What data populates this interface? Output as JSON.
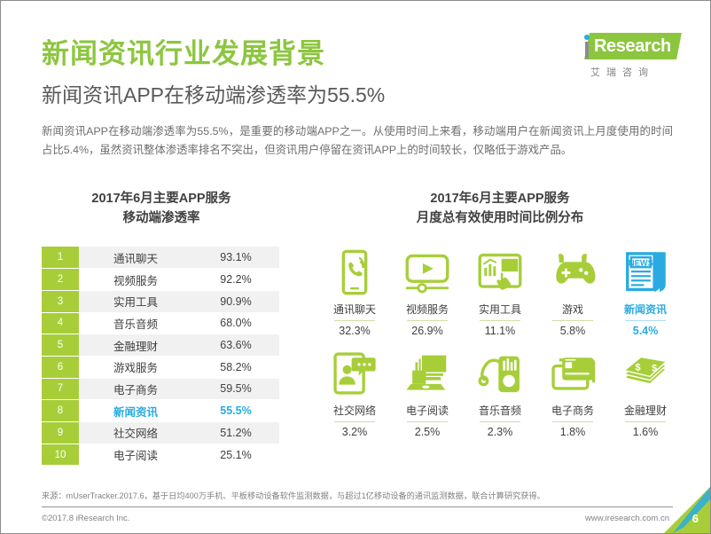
{
  "header": {
    "title": "新闻资讯行业发展背景",
    "subtitle": "新闻资讯APP在移动端渗透率为55.5%",
    "title_color": "#8cc63f",
    "subtitle_color": "#58595b"
  },
  "logo": {
    "word": "Research",
    "cn": "艾瑞咨询",
    "green": "#8cc63f",
    "blue": "#29abe2"
  },
  "intro": {
    "paragraph": "新闻资讯APP在移动端渗透率为55.5%，是重要的移动端APP之一。从使用时间上来看，移动端用户在新闻资讯上月度使用的时间占比5.4%，虽然资讯整体渗透率排名不突出，但资讯用户停留在资讯APP上的时间较长，仅略低于游戏产品。"
  },
  "left_panel": {
    "title_line1": "2017年6月主要APP服务",
    "title_line2": "移动端渗透率",
    "rows": [
      {
        "rank": "1",
        "name": "通讯聊天",
        "value": "93.1%",
        "highlight": false
      },
      {
        "rank": "2",
        "name": "视频服务",
        "value": "92.2%",
        "highlight": false
      },
      {
        "rank": "3",
        "name": "实用工具",
        "value": "90.9%",
        "highlight": false
      },
      {
        "rank": "4",
        "name": "音乐音频",
        "value": "68.0%",
        "highlight": false
      },
      {
        "rank": "5",
        "name": "金融理财",
        "value": "63.6%",
        "highlight": false
      },
      {
        "rank": "6",
        "name": "游戏服务",
        "value": "58.2%",
        "highlight": false
      },
      {
        "rank": "7",
        "name": "电子商务",
        "value": "59.5%",
        "highlight": false
      },
      {
        "rank": "8",
        "name": "新闻资讯",
        "value": "55.5%",
        "highlight": true
      },
      {
        "rank": "9",
        "name": "社交网络",
        "value": "51.2%",
        "highlight": false
      },
      {
        "rank": "10",
        "name": "电子阅读",
        "value": "25.1%",
        "highlight": false
      }
    ]
  },
  "right_panel": {
    "title_line1": "2017年6月主要APP服务",
    "title_line2": "月度总有效使用时间比例分布",
    "items": [
      {
        "icon": "phone-chat-icon",
        "label": "通讯聊天",
        "value": "32.3%",
        "highlight": false
      },
      {
        "icon": "video-play-icon",
        "label": "视频服务",
        "value": "26.9%",
        "highlight": false
      },
      {
        "icon": "tablet-tools-icon",
        "label": "实用工具",
        "value": "11.1%",
        "highlight": false
      },
      {
        "icon": "gamepad-icon",
        "label": "游戏",
        "value": "5.8%",
        "highlight": false
      },
      {
        "icon": "newspaper-icon",
        "label": "新闻资讯",
        "value": "5.4%",
        "highlight": true
      },
      {
        "icon": "social-avatar-icon",
        "label": "社交网络",
        "value": "3.2%",
        "highlight": false
      },
      {
        "icon": "ebook-laptop-icon",
        "label": "电子阅读",
        "value": "2.5%",
        "highlight": false
      },
      {
        "icon": "music-player-icon",
        "label": "音乐音频",
        "value": "2.3%",
        "highlight": false
      },
      {
        "icon": "credit-card-icon",
        "label": "电子商务",
        "value": "1.8%",
        "highlight": false
      },
      {
        "icon": "money-stack-icon",
        "label": "金融理财",
        "value": "1.6%",
        "highlight": false
      }
    ]
  },
  "chart_data": {
    "type": "bar",
    "title": "2017年6月主要APP服务 月度总有效使用时间比例分布",
    "categories": [
      "通讯聊天",
      "视频服务",
      "实用工具",
      "游戏",
      "新闻资讯",
      "社交网络",
      "电子阅读",
      "音乐音频",
      "电子商务",
      "金融理财"
    ],
    "values": [
      32.3,
      26.9,
      11.1,
      5.8,
      5.4,
      3.2,
      2.5,
      2.3,
      1.8,
      1.6
    ],
    "unit": "%",
    "secondary": {
      "type": "table",
      "title": "2017年6月主要APP服务 移动端渗透率",
      "categories": [
        "通讯聊天",
        "视频服务",
        "实用工具",
        "音乐音频",
        "金融理财",
        "游戏服务",
        "电子商务",
        "新闻资讯",
        "社交网络",
        "电子阅读"
      ],
      "values": [
        93.1,
        92.2,
        90.9,
        68.0,
        63.6,
        58.2,
        59.5,
        55.5,
        51.2,
        25.1
      ],
      "unit": "%"
    }
  },
  "footer": {
    "source": "来源：mUserTracker.2017.6，基于日均400万手机、平板移动设备软件监测数据，与超过1亿移动设备的通讯监测数据，联合计算研究获得。",
    "copyright": "©2017.8 iResearch Inc.",
    "website": "www.iresearch.com.cn",
    "page_number": "6"
  }
}
